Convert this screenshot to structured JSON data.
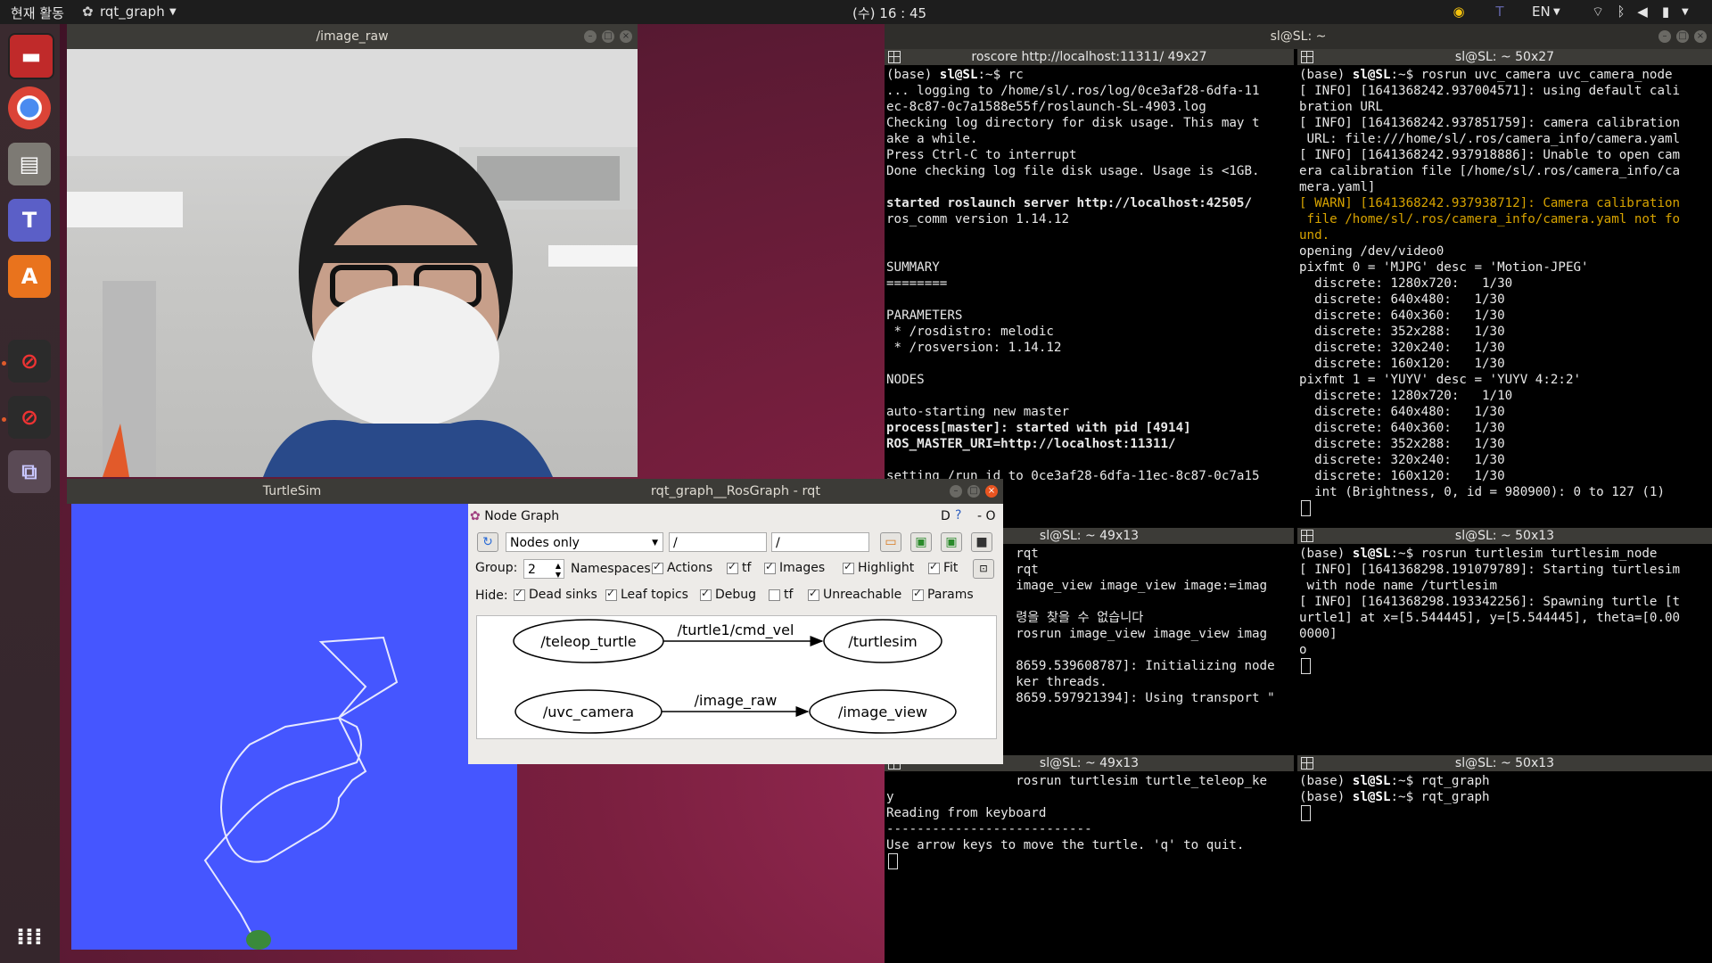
{
  "topbar": {
    "activities": "현재 활동",
    "app_name": "rqt_graph",
    "clock": "(수) 16 : 45",
    "lang": "EN"
  },
  "dock": {
    "icons": [
      "terminal-icon",
      "chrome-icon",
      "files-icon",
      "teams-icon",
      "software-icon",
      "blocked-app-icon",
      "blocked-app-icon",
      "rqt-icon",
      "app-grid-icon"
    ]
  },
  "image_raw_window": {
    "title": "/image_raw"
  },
  "turtlesim_window": {
    "title": "TurtleSim"
  },
  "terminal_window": {
    "title": "sl@SL: ~"
  },
  "terminals": {
    "t1": {
      "header": "roscore http://localhost:11311/ 49x27",
      "lines": [
        {
          "p": "(base) ",
          "u": "sl@SL",
          "r": ":~$ rc"
        },
        {
          "t": "... logging to /home/sl/.ros/log/0ce3af28-6dfa-11"
        },
        {
          "t": "ec-8c87-0c7a1588e55f/roslaunch-SL-4903.log"
        },
        {
          "t": "Checking log directory for disk usage. This may t"
        },
        {
          "t": "ake a while."
        },
        {
          "t": "Press Ctrl-C to interrupt"
        },
        {
          "t": "Done checking log file disk usage. Usage is <1GB."
        },
        {
          "t": ""
        },
        {
          "b": "started roslaunch server http://localhost:42505/"
        },
        {
          "t": "ros_comm version 1.14.12"
        },
        {
          "t": ""
        },
        {
          "t": ""
        },
        {
          "t": "SUMMARY"
        },
        {
          "t": "========"
        },
        {
          "t": ""
        },
        {
          "t": "PARAMETERS"
        },
        {
          "t": " * /rosdistro: melodic"
        },
        {
          "t": " * /rosversion: 1.14.12"
        },
        {
          "t": ""
        },
        {
          "t": "NODES"
        },
        {
          "t": ""
        },
        {
          "t": "auto-starting new master"
        },
        {
          "b": "process[master]: started with pid [4914]"
        },
        {
          "b": "ROS_MASTER_URI=http://localhost:11311/"
        },
        {
          "t": ""
        },
        {
          "t": "setting /run_id to 0ce3af28-6dfa-11ec-8c87-0c7a15"
        }
      ]
    },
    "t2": {
      "header": "sl@SL: ~ 50x27",
      "lines": [
        {
          "p": "(base) ",
          "u": "sl@SL",
          "r": ":~$ rosrun uvc_camera uvc_camera_node"
        },
        {
          "t": "[ INFO] [1641368242.937004571]: using default cali"
        },
        {
          "t": "bration URL"
        },
        {
          "t": "[ INFO] [1641368242.937851759]: camera calibration"
        },
        {
          "t": " URL: file:///home/sl/.ros/camera_info/camera.yaml"
        },
        {
          "t": "[ INFO] [1641368242.937918886]: Unable to open cam"
        },
        {
          "t": "era calibration file [/home/sl/.ros/camera_info/ca"
        },
        {
          "t": "mera.yaml]"
        },
        {
          "w": "[ WARN] [1641368242.937938712]: Camera calibration"
        },
        {
          "w": " file /home/sl/.ros/camera_info/camera.yaml not fo"
        },
        {
          "w": "und."
        },
        {
          "t": "opening /dev/video0"
        },
        {
          "t": "pixfmt 0 = 'MJPG' desc = 'Motion-JPEG'"
        },
        {
          "t": "  discrete: 1280x720:   1/30"
        },
        {
          "t": "  discrete: 640x480:   1/30"
        },
        {
          "t": "  discrete: 640x360:   1/30"
        },
        {
          "t": "  discrete: 352x288:   1/30"
        },
        {
          "t": "  discrete: 320x240:   1/30"
        },
        {
          "t": "  discrete: 160x120:   1/30"
        },
        {
          "t": "pixfmt 1 = 'YUYV' desc = 'YUYV 4:2:2'"
        },
        {
          "t": "  discrete: 1280x720:   1/10"
        },
        {
          "t": "  discrete: 640x480:   1/30"
        },
        {
          "t": "  discrete: 640x360:   1/30"
        },
        {
          "t": "  discrete: 352x288:   1/30"
        },
        {
          "t": "  discrete: 320x240:   1/30"
        },
        {
          "t": "  discrete: 160x120:   1/30"
        },
        {
          "t": "  int (Brightness, 0, id = 980900): 0 to 127 (1)"
        }
      ]
    },
    "t3": {
      "header": "sl@SL: ~ 49x13",
      "lines": [
        {
          "t": "                 rqt"
        },
        {
          "t": "                 rqt"
        },
        {
          "t": "                 image_view image_view image:=imag"
        },
        {
          "t": ""
        },
        {
          "t": "                 령을 찾을 수 없습니다"
        },
        {
          "t": "                 rosrun image_view image_view imag"
        },
        {
          "t": ""
        },
        {
          "t": "                 8659.539608787]: Initializing node"
        },
        {
          "t": "                 ker threads."
        },
        {
          "t": "                 8659.597921394]: Using transport \""
        }
      ]
    },
    "t4": {
      "header": "sl@SL: ~ 50x13",
      "lines": [
        {
          "p": "(base) ",
          "u": "sl@SL",
          "r": ":~$ rosrun turtlesim turtlesim_node"
        },
        {
          "t": "[ INFO] [1641368298.191079789]: Starting turtlesim"
        },
        {
          "t": " with node name /turtlesim"
        },
        {
          "t": "[ INFO] [1641368298.193342256]: Spawning turtle [t"
        },
        {
          "t": "urtle1] at x=[5.544445], y=[5.544445], theta=[0.00"
        },
        {
          "t": "0000]"
        },
        {
          "t": "o"
        }
      ]
    },
    "t5": {
      "header": "sl@SL: ~ 49x13",
      "lines": [
        {
          "t": "                 rosrun turtlesim turtle_teleop_ke"
        },
        {
          "t": "y"
        },
        {
          "t": "Reading from keyboard"
        },
        {
          "t": "---------------------------"
        },
        {
          "t": "Use arrow keys to move the turtle. 'q' to quit."
        }
      ]
    },
    "t6": {
      "header": "sl@SL: ~ 50x13",
      "lines": [
        {
          "p": "(base) ",
          "u": "sl@SL",
          "r": ":~$ rqt_graph"
        },
        {
          "p": "(base) ",
          "u": "sl@SL",
          "r": ":~$ rqt_graph"
        }
      ]
    }
  },
  "rqt": {
    "title": "rqt_graph__RosGraph - rqt",
    "panel_title": "Node Graph",
    "dropdown": "Nodes only",
    "filter1": "/",
    "filter2": "/",
    "group_label": "Group:",
    "group_value": "2",
    "namespaces": "Namespaces",
    "actions": "Actions",
    "tf": "tf",
    "images": "Images",
    "highlight": "Highlight",
    "fit": "Fit",
    "hide_label": "Hide:",
    "dead_sinks": "Dead sinks",
    "leaf_topics": "Leaf topics",
    "debug": "Debug",
    "tf2": "tf",
    "unreachable": "Unreachable",
    "params": "Params",
    "panel_right": "D",
    "panel_right2": "- O",
    "graph": {
      "nodes": [
        "/teleop_turtle",
        "/turtlesim",
        "/uvc_camera",
        "/image_view"
      ],
      "edges": [
        "/turtle1/cmd_vel",
        "/image_raw"
      ]
    }
  }
}
